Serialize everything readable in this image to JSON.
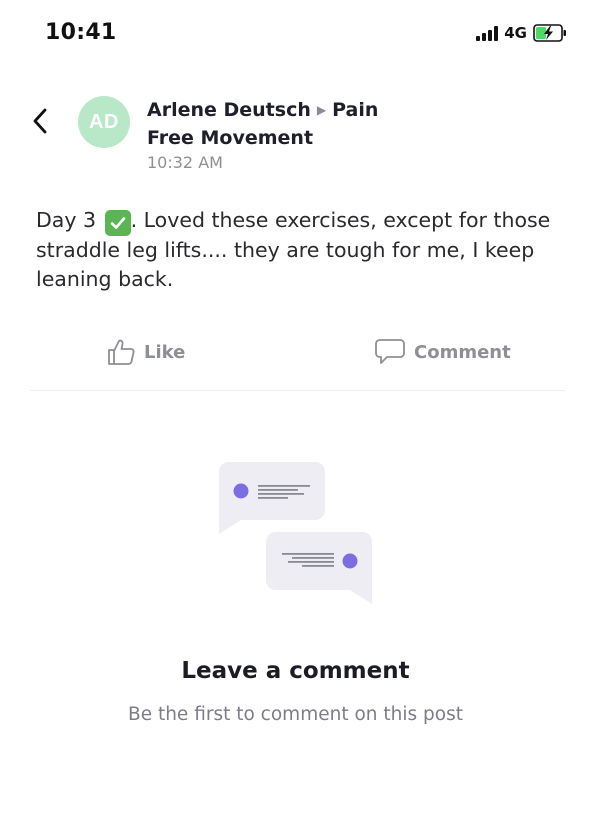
{
  "status_bar": {
    "time": "10:41",
    "network": "4G",
    "battery_color": "#4cd964"
  },
  "post": {
    "avatar_initials": "AD",
    "avatar_color": "#b8e8c8",
    "author": "Arlene Deutsch",
    "group": "Pain Free Movement",
    "time": "10:32 AM",
    "body_prefix": "Day 3",
    "body_emoji": "check-mark-button-emoji",
    "body_text": ".   Loved these exercises, except for those straddle leg lifts.... they are tough for me, I keep leaning back."
  },
  "actions": {
    "like_label": "Like",
    "comment_label": "Comment"
  },
  "empty_state": {
    "illustration": "chat-bubbles-illustration",
    "accent_color": "#7b6fe0",
    "title": "Leave a comment",
    "subtitle": "Be the first to comment on this post"
  }
}
